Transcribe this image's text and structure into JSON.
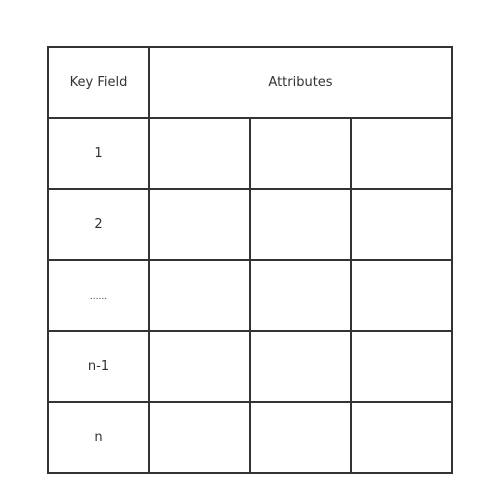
{
  "table": {
    "header": {
      "key_label": "Key Field",
      "attributes_label": "Attributes"
    },
    "rows": [
      {
        "key": "1"
      },
      {
        "key": "2"
      },
      {
        "key": "......"
      },
      {
        "key": "n-1"
      },
      {
        "key": "n"
      }
    ]
  }
}
